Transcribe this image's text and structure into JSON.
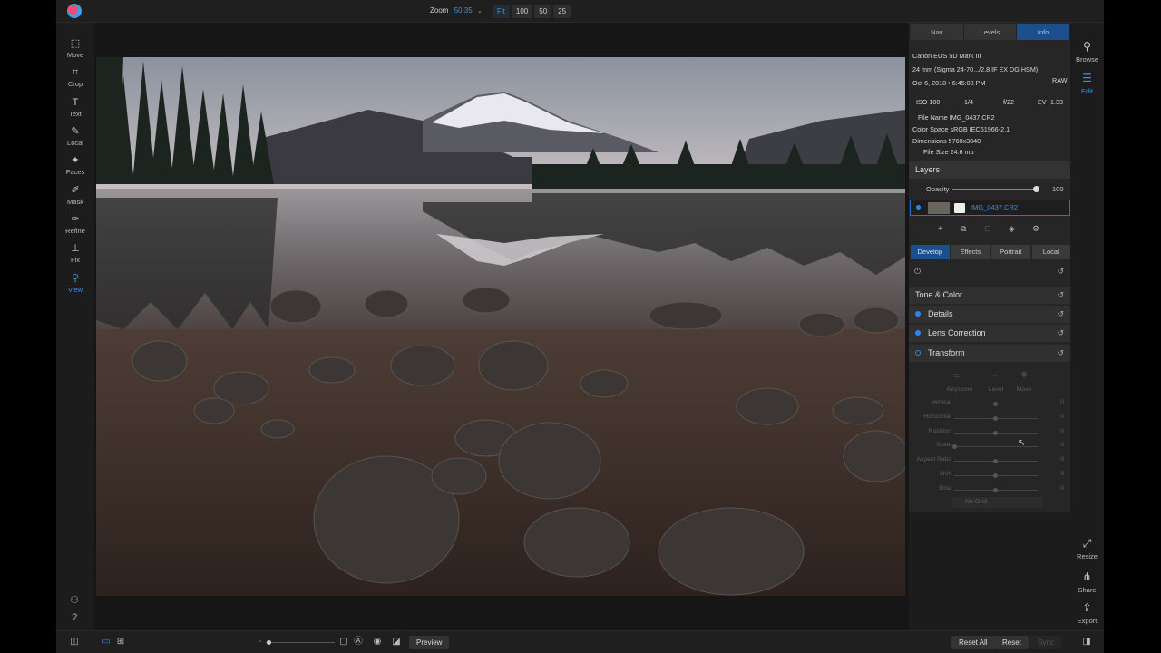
{
  "topbar": {
    "zoom_label": "Zoom",
    "zoom_value": "50.35",
    "zoom_buttons": [
      "Fit",
      "100",
      "50",
      "25"
    ]
  },
  "left_tools": [
    {
      "label": "Move",
      "icon": "select-icon"
    },
    {
      "label": "Crop",
      "icon": "crop-icon"
    },
    {
      "label": "Text",
      "icon": "text-icon"
    },
    {
      "label": "Local",
      "icon": "brush-icon"
    },
    {
      "label": "Faces",
      "icon": "faces-icon"
    },
    {
      "label": "Mask",
      "icon": "mask-icon"
    },
    {
      "label": "Refine",
      "icon": "refine-icon"
    },
    {
      "label": "Fix",
      "icon": "stamp-icon"
    },
    {
      "label": "View",
      "icon": "magnifier-icon"
    }
  ],
  "panel": {
    "tabs": [
      "Nav",
      "Levels",
      "Info"
    ],
    "camera": "Canon EOS 5D Mark III",
    "lens": "24 mm (Sigma 24-70.../2.8 IF EX DG HSM)",
    "raw_badge": "RAW",
    "date": "Oct 6, 2018 • 6:45:03 PM",
    "iso": "ISO 100",
    "shutter": "1/4",
    "aperture": "f/22",
    "ev": "EV -1.33",
    "file_name": "File Name IMG_0437.CR2",
    "color_space": "Color Space sRGB IEC61966-2.1",
    "dimensions": "Dimensions 5760x3840",
    "file_size": "File Size 24.6 mb",
    "layers_title": "Layers",
    "opacity_label": "Opacity",
    "opacity_value": "100",
    "layer_name": "IMG_0437.CR2",
    "dev_tabs": [
      "Develop",
      "Effects",
      "Portrait",
      "Local"
    ],
    "sections": [
      "Tone & Color",
      "Details",
      "Lens Correction",
      "Transform"
    ],
    "transform_modes": [
      "Keystone",
      "Level",
      "Move"
    ],
    "transform_sliders": [
      {
        "label": "Vertical",
        "value": "0"
      },
      {
        "label": "Horizontal",
        "value": "0"
      },
      {
        "label": "Rotation",
        "value": "0"
      },
      {
        "label": "Scale",
        "value": "0"
      },
      {
        "label": "Aspect Ratio",
        "value": "0"
      },
      {
        "label": "Shift",
        "value": "0"
      },
      {
        "label": "Rise",
        "value": "0"
      }
    ],
    "grid_option": "No Grid"
  },
  "right_tools": {
    "browse": "Browse",
    "edit": "Edit",
    "resize": "Resize",
    "share": "Share",
    "export": "Export"
  },
  "bottombar": {
    "preview": "Preview",
    "reset_all": "Reset All",
    "reset": "Reset",
    "sync": "Sync"
  },
  "colors": {
    "accent": "#3b8fe6",
    "panel": "#262626",
    "background": "#1c1c1c"
  }
}
